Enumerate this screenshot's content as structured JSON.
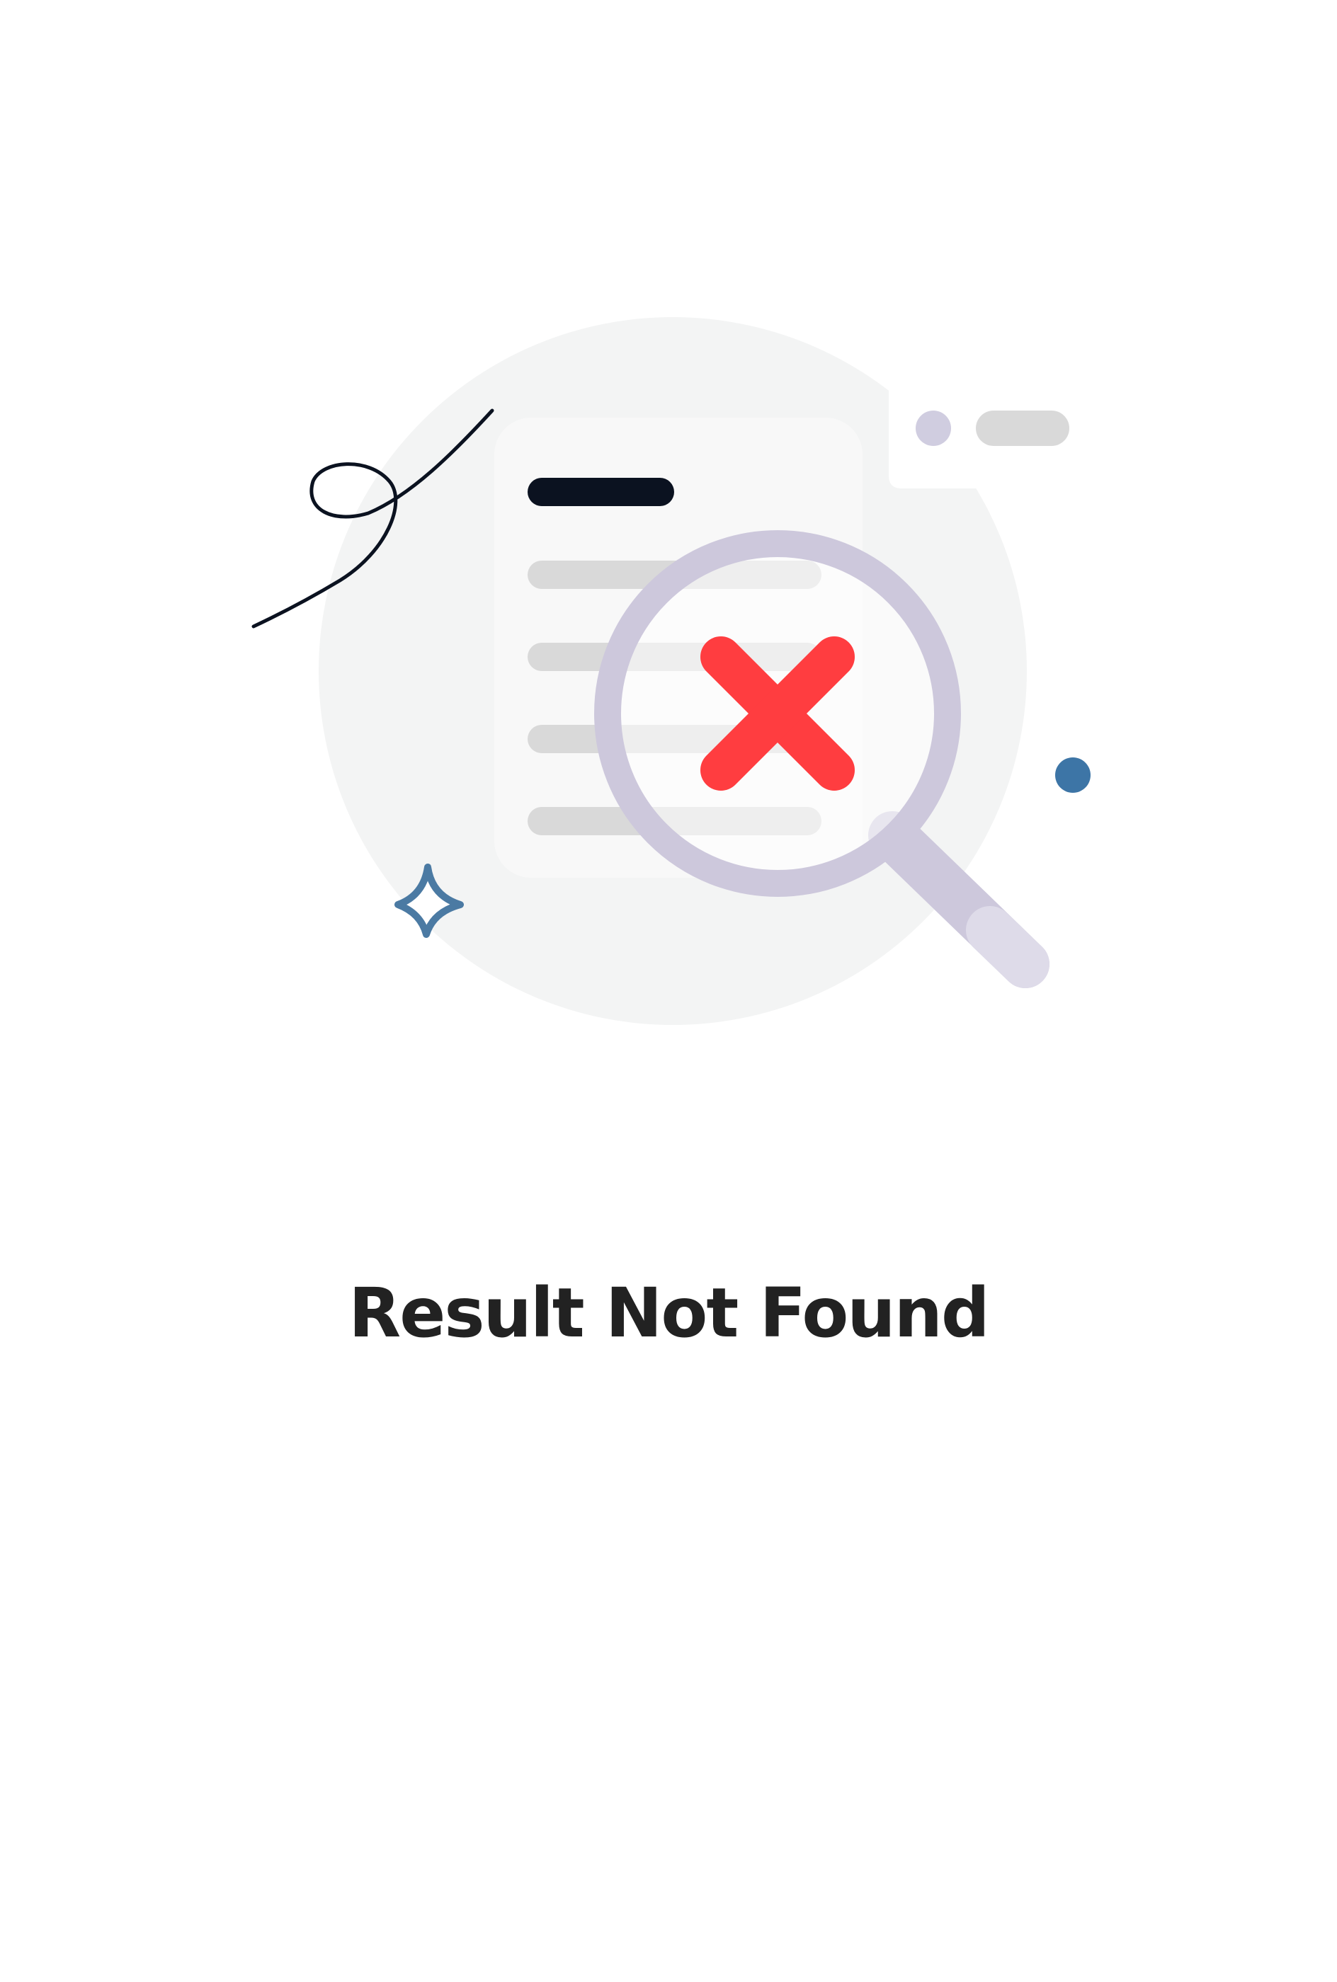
{
  "empty_state": {
    "title": "Result Not Found",
    "illustration_icon": "search-no-result-icon"
  },
  "colors": {
    "background": "#ffffff",
    "circle": "#f3f4f4",
    "document": "#f8f8f8",
    "document_header_line": "#0b1220",
    "document_lines": "#d9d9d9",
    "magnifier": "#cdc8dc",
    "magnifier_handle_tip": "#dedbe9",
    "cross": "#ff3d40",
    "sparkle": "#4b7aa3",
    "dot_blue": "#3d75a6",
    "dot_lavender": "#d0cde0",
    "pill": "#d9d9d9",
    "title": "#222222"
  }
}
